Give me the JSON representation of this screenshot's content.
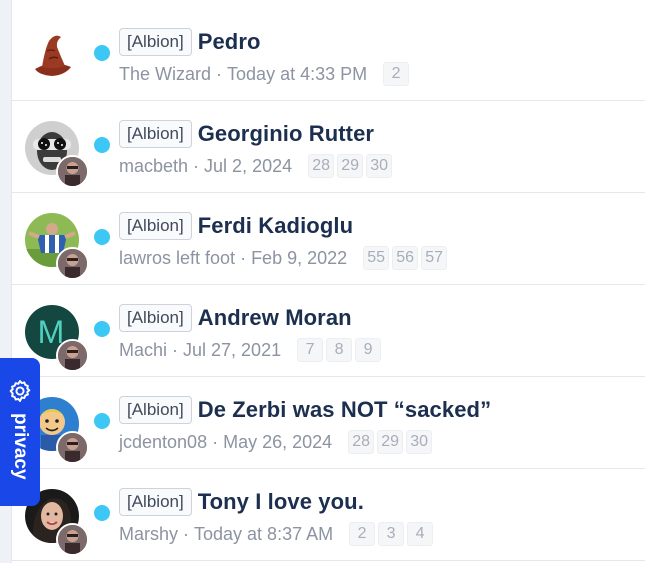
{
  "threads": [
    {
      "prefix": "[Albion]",
      "title": "Pedro",
      "user": "The Wizard",
      "date": "Today at 4:33 PM",
      "pages": [
        "2"
      ],
      "avatar": "wizard-hat"
    },
    {
      "prefix": "[Albion]",
      "title": "Georginio Rutter",
      "user": "macbeth",
      "date": "Jul 2, 2024",
      "pages": [
        "28",
        "29",
        "30"
      ],
      "avatar": "photo"
    },
    {
      "prefix": "[Albion]",
      "title": "Ferdi Kadioglu",
      "user": "lawros left foot",
      "date": "Feb 9, 2022",
      "pages": [
        "55",
        "56",
        "57"
      ],
      "avatar": "photo"
    },
    {
      "prefix": "[Albion]",
      "title": "Andrew Moran",
      "user": "Machi",
      "date": "Jul 27, 2021",
      "pages": [
        "7",
        "8",
        "9"
      ],
      "avatar": "letter",
      "avatar_letter": "M"
    },
    {
      "prefix": "[Albion]",
      "title": "De Zerbi was NOT “sacked”",
      "user": "jcdenton08",
      "date": "May 26, 2024",
      "pages": [
        "28",
        "29",
        "30"
      ],
      "avatar": "cartoon"
    },
    {
      "prefix": "[Albion]",
      "title": "Tony I love you.",
      "user": "Marshy",
      "date": "Today at 8:37 AM",
      "pages": [
        "2",
        "3",
        "4"
      ],
      "avatar": "photo"
    }
  ],
  "privacy": {
    "label": "privacy",
    "icon": "gear-icon"
  },
  "colors": {
    "accent": "#1a47e8",
    "unread": "#3cc7f5",
    "title": "#1c2f4f",
    "meta": "#8c93a1"
  }
}
